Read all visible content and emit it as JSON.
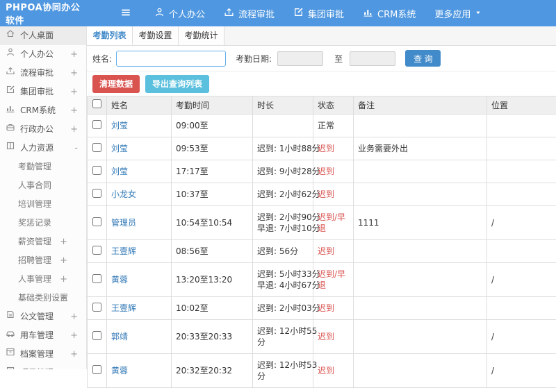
{
  "colors": {
    "header_blue": "#4f97e0",
    "accent_blue": "#428bca",
    "danger_red": "#d9534f",
    "info_teal": "#5bc0de",
    "link_blue": "#337ab7"
  },
  "header": {
    "logo": "PHPOA协同办公软件",
    "nav": [
      {
        "label": "个人办公",
        "icon": "user-icon"
      },
      {
        "label": "流程审批",
        "icon": "flow-icon"
      },
      {
        "label": "集团审批",
        "icon": "edit-icon"
      },
      {
        "label": "CRM系统",
        "icon": "chart-icon"
      },
      {
        "label": "更多应用",
        "icon": "caret-down-icon"
      }
    ]
  },
  "sidebar": {
    "items": [
      {
        "label": "个人桌面",
        "icon": "home-icon",
        "toggle": ""
      },
      {
        "label": "个人办公",
        "icon": "user-icon",
        "toggle": "+"
      },
      {
        "label": "流程审批",
        "icon": "flow-icon",
        "toggle": "+"
      },
      {
        "label": "集团审批",
        "icon": "edit-icon",
        "toggle": "+"
      },
      {
        "label": "CRM系统",
        "icon": "chart-icon",
        "toggle": "+"
      },
      {
        "label": "行政办公",
        "icon": "briefcase-icon",
        "toggle": "+"
      },
      {
        "label": "人力资源",
        "icon": "hr-icon",
        "toggle": "-"
      }
    ],
    "hr_children": [
      {
        "label": "考勤管理",
        "toggle": ""
      },
      {
        "label": "人事合同",
        "toggle": ""
      },
      {
        "label": "培训管理",
        "toggle": ""
      },
      {
        "label": "奖惩记录",
        "toggle": ""
      },
      {
        "label": "薪资管理",
        "toggle": "+"
      },
      {
        "label": "招聘管理",
        "toggle": "+"
      },
      {
        "label": "人事管理",
        "toggle": "+"
      },
      {
        "label": "基础类别设置",
        "toggle": "+"
      }
    ],
    "items_bottom": [
      {
        "label": "公文管理",
        "icon": "doc-icon",
        "toggle": "+"
      },
      {
        "label": "用车管理",
        "icon": "car-icon",
        "toggle": "+"
      },
      {
        "label": "档案管理",
        "icon": "archive-icon",
        "toggle": "+"
      },
      {
        "label": "项目管理",
        "icon": "project-icon",
        "toggle": "+"
      }
    ]
  },
  "tabs": [
    {
      "label": "考勤列表",
      "active": true
    },
    {
      "label": "考勤设置",
      "active": false
    },
    {
      "label": "考勤统计",
      "active": false
    }
  ],
  "form": {
    "name_label": "姓名:",
    "name_value": "",
    "date_label": "考勤日期:",
    "date_from": "",
    "to_label": "至",
    "date_to": "",
    "search_button": "查 询"
  },
  "toolbar": {
    "clean_button": "清理数据",
    "export_button": "导出查询列表"
  },
  "table": {
    "columns": [
      "姓名",
      "考勤时间",
      "时长",
      "状态",
      "备注",
      "位置"
    ],
    "rows": [
      {
        "name": "刘莹",
        "time": "09:00至",
        "duration": "",
        "status": "正常",
        "status_class": "st-normal",
        "remark": "",
        "location": ""
      },
      {
        "name": "刘莹",
        "time": "09:53至",
        "duration": "迟到: 1小时88分",
        "status": "迟到",
        "status_class": "st-late",
        "remark": "业务需要外出",
        "location": ""
      },
      {
        "name": "刘莹",
        "time": "17:17至",
        "duration": "迟到: 9小时28分",
        "status": "迟到",
        "status_class": "st-late",
        "remark": "",
        "location": ""
      },
      {
        "name": "小龙女",
        "time": "10:37至",
        "duration": "迟到: 2小时62分",
        "status": "迟到",
        "status_class": "st-late",
        "remark": "",
        "location": ""
      },
      {
        "name": "管理员",
        "time": "10:54至10:54",
        "duration": "迟到: 2小时90分\n早退: 7小时10分",
        "status": "迟到/早退",
        "status_class": "st-late",
        "remark": "1111",
        "location": "/"
      },
      {
        "name": "王壹辉",
        "time": "08:56至",
        "duration": "迟到: 56分",
        "status": "迟到",
        "status_class": "st-late",
        "remark": "",
        "location": ""
      },
      {
        "name": "黄蓉",
        "time": "13:20至13:20",
        "duration": "迟到: 5小时33分\n早退: 4小时67分",
        "status": "迟到/早退",
        "status_class": "st-late",
        "remark": "",
        "location": "/"
      },
      {
        "name": "王壹辉",
        "time": "10:02至",
        "duration": "迟到: 2小时03分",
        "status": "迟到",
        "status_class": "st-late",
        "remark": "",
        "location": ""
      },
      {
        "name": "郭靖",
        "time": "20:33至20:33",
        "duration": "迟到: 12小时55\n分",
        "status": "迟到",
        "status_class": "st-late",
        "remark": "",
        "location": "/"
      },
      {
        "name": "黄蓉",
        "time": "20:32至20:32",
        "duration": "迟到: 12小时53\n分",
        "status": "迟到",
        "status_class": "st-late",
        "remark": "",
        "location": "/"
      }
    ]
  }
}
